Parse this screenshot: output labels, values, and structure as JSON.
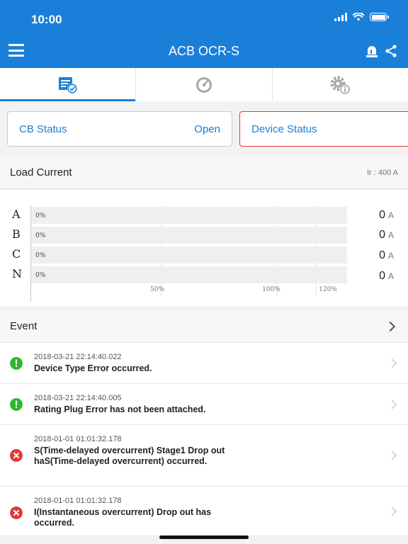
{
  "status_bar": {
    "time": "10:00"
  },
  "app_bar": {
    "title": "ACB OCR-S",
    "icons": [
      "menu-icon",
      "alarm-icon",
      "share-icon"
    ]
  },
  "tabs": [
    {
      "icon": "status-report-icon",
      "active": true
    },
    {
      "icon": "gauge-icon",
      "active": false
    },
    {
      "icon": "settings-info-icon",
      "active": false
    }
  ],
  "cb_status": {
    "label": "CB Status",
    "value": "Open"
  },
  "device_status": {
    "label": "Device Status"
  },
  "load_current": {
    "title": "Load Current",
    "ir": "Ir : 400 A",
    "rows": [
      {
        "label": "A",
        "pct": "0%",
        "value": "0",
        "unit": "A"
      },
      {
        "label": "B",
        "pct": "0%",
        "value": "0",
        "unit": "A"
      },
      {
        "label": "C",
        "pct": "0%",
        "value": "0",
        "unit": "A"
      },
      {
        "label": "N",
        "pct": "0%",
        "value": "0",
        "unit": "A"
      }
    ],
    "ticks": [
      "50%",
      "100%",
      "120%"
    ]
  },
  "events": {
    "title": "Event",
    "items": [
      {
        "time": "2018-03-21 22:14:40.022",
        "msg": "Device Type Error occurred.",
        "level": "warning"
      },
      {
        "time": "2018-03-21 22:14:40.005",
        "msg": "Rating Plug Error has not been attached.",
        "level": "warning"
      },
      {
        "time": "2018-01-01 01:01:32.178",
        "msg": "S(Time-delayed overcurrent) Stage1 Drop out haS(Time-delayed overcurrent) occurred.",
        "level": "error"
      },
      {
        "time": "2018-01-01 01:01:32.178",
        "msg": "I(Instantaneous overcurrent) Drop out has occurred.",
        "level": "error"
      }
    ]
  },
  "colors": {
    "primary": "#1a7fd9",
    "alert": "#e03a3a",
    "ok": "#2db82d"
  }
}
